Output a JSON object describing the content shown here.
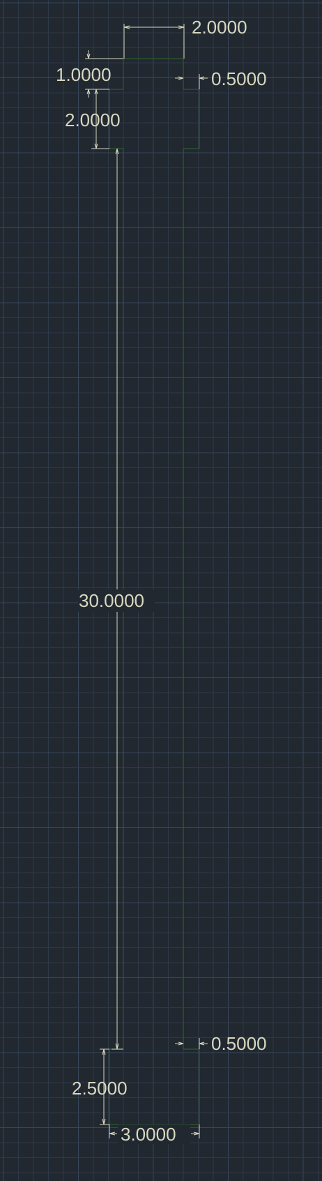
{
  "drawing": {
    "background_color": "#212830",
    "grid_color": "#2e3947",
    "grid_major_color": "#38465a",
    "outline_color": "#2f5a2a",
    "dimension_color": "#d8d8c0"
  },
  "dimensions": {
    "top_width": "2.0000",
    "top_height": "1.0000",
    "upper_offset": "0.5000",
    "upper_height": "2.0000",
    "shaft_length": "30.0000",
    "lower_offset": "0.5000",
    "bottom_height": "2.5000",
    "bottom_width": "3.0000"
  }
}
